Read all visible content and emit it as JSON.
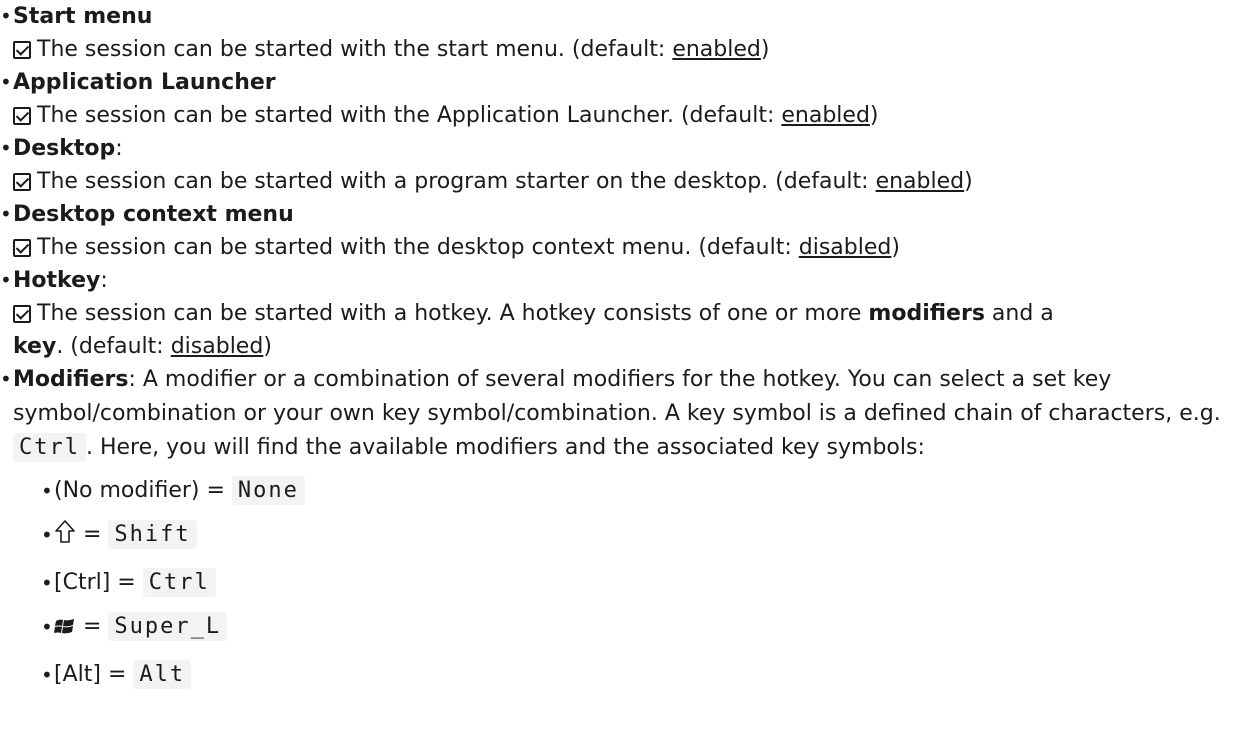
{
  "items": [
    {
      "label": "Start menu",
      "text": "The session can be started with the start menu. (default: ",
      "default": "enabled",
      "tail": ")"
    },
    {
      "label": "Application Launcher",
      "text": "The session can be started with the Application Launcher. (default: ",
      "default": "enabled",
      "tail": ")"
    },
    {
      "label": "Desktop",
      "label_suffix": ":",
      "text": "The session can be started with a program starter on the desktop. (default: ",
      "default": "enabled",
      "tail": ")"
    },
    {
      "label": "Desktop context menu",
      "text": "The session can be started with the desktop context menu. (default: ",
      "default": "disabled",
      "tail": ")"
    },
    {
      "label": "Hotkey",
      "label_suffix": ":",
      "text_a": "The session can be started with a hotkey. A hotkey consists of one or more ",
      "bold_a": "modifiers",
      "text_b": " and a",
      "bold_b": "key",
      "text_c": ". (default: ",
      "default": "disabled",
      "tail": ")"
    }
  ],
  "modifiers": {
    "label": "Modifiers",
    "label_suffix": ":",
    "text_a": " A modifier or a combination of several modifiers for the hotkey. You can select a set key symbol/combination or your own key symbol/combination. A key symbol is a defined chain of characters, e.g. ",
    "example_code": "Ctrl",
    "text_b": ". Here, you will find the available modifiers and the associated key symbols:",
    "list": [
      {
        "label": "(No modifier)",
        "eq": " = ",
        "code": "None",
        "icon": "none"
      },
      {
        "label": "",
        "eq": " = ",
        "code": "Shift",
        "icon": "shift-arrow-icon"
      },
      {
        "label": "[Ctrl]",
        "eq": " = ",
        "code": "Ctrl",
        "icon": "none"
      },
      {
        "label": "",
        "eq": " = ",
        "code": "Super_L",
        "icon": "windows-logo-icon"
      },
      {
        "label": "[Alt]",
        "eq": " = ",
        "code": "Alt",
        "icon": "none"
      }
    ]
  }
}
